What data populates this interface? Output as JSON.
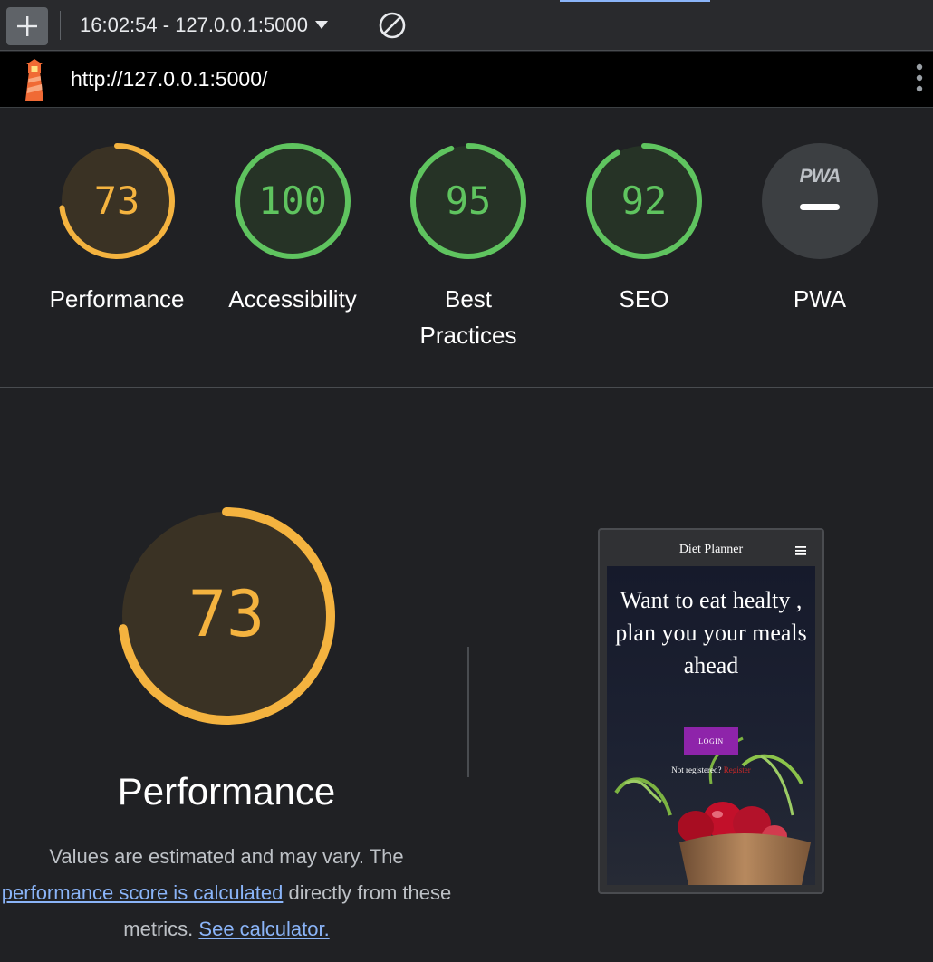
{
  "toolbar": {
    "report_label": "16:02:54 - 127.0.0.1:5000",
    "new_icon": "plus-icon",
    "clear_icon": "block-icon"
  },
  "urlbar": {
    "url": "http://127.0.0.1:5000/",
    "logo_icon": "lighthouse-icon",
    "menu_icon": "kebab-icon"
  },
  "colors": {
    "average": "#f4b33f",
    "pass": "#5fc45f",
    "na": "#3c3f42"
  },
  "scores": [
    {
      "id": "performance",
      "value": "73",
      "score": 73,
      "label": "Performance",
      "status": "average"
    },
    {
      "id": "accessibility",
      "value": "100",
      "score": 100,
      "label": "Accessibility",
      "status": "pass"
    },
    {
      "id": "best-practices",
      "value": "95",
      "score": 95,
      "label": "Best Practices",
      "status": "pass"
    },
    {
      "id": "seo",
      "value": "92",
      "score": 92,
      "label": "SEO",
      "status": "pass"
    },
    {
      "id": "pwa",
      "badge": "PWA",
      "score": null,
      "label": "PWA",
      "status": "na"
    }
  ],
  "performance": {
    "score": "73",
    "title": "Performance",
    "desc_prefix": "Values are estimated and may vary. The ",
    "desc_link": "performance score is calculated",
    "desc_middle": " directly from these metrics. ",
    "desc_calc_link": "See calculator."
  },
  "screenshot": {
    "site_title": "Diet Planner",
    "heading": "Want to eat healty , plan you your meals ahead",
    "login_label": "LOGIN",
    "register_prefix": "Not registered? ",
    "register_link": "Register"
  }
}
